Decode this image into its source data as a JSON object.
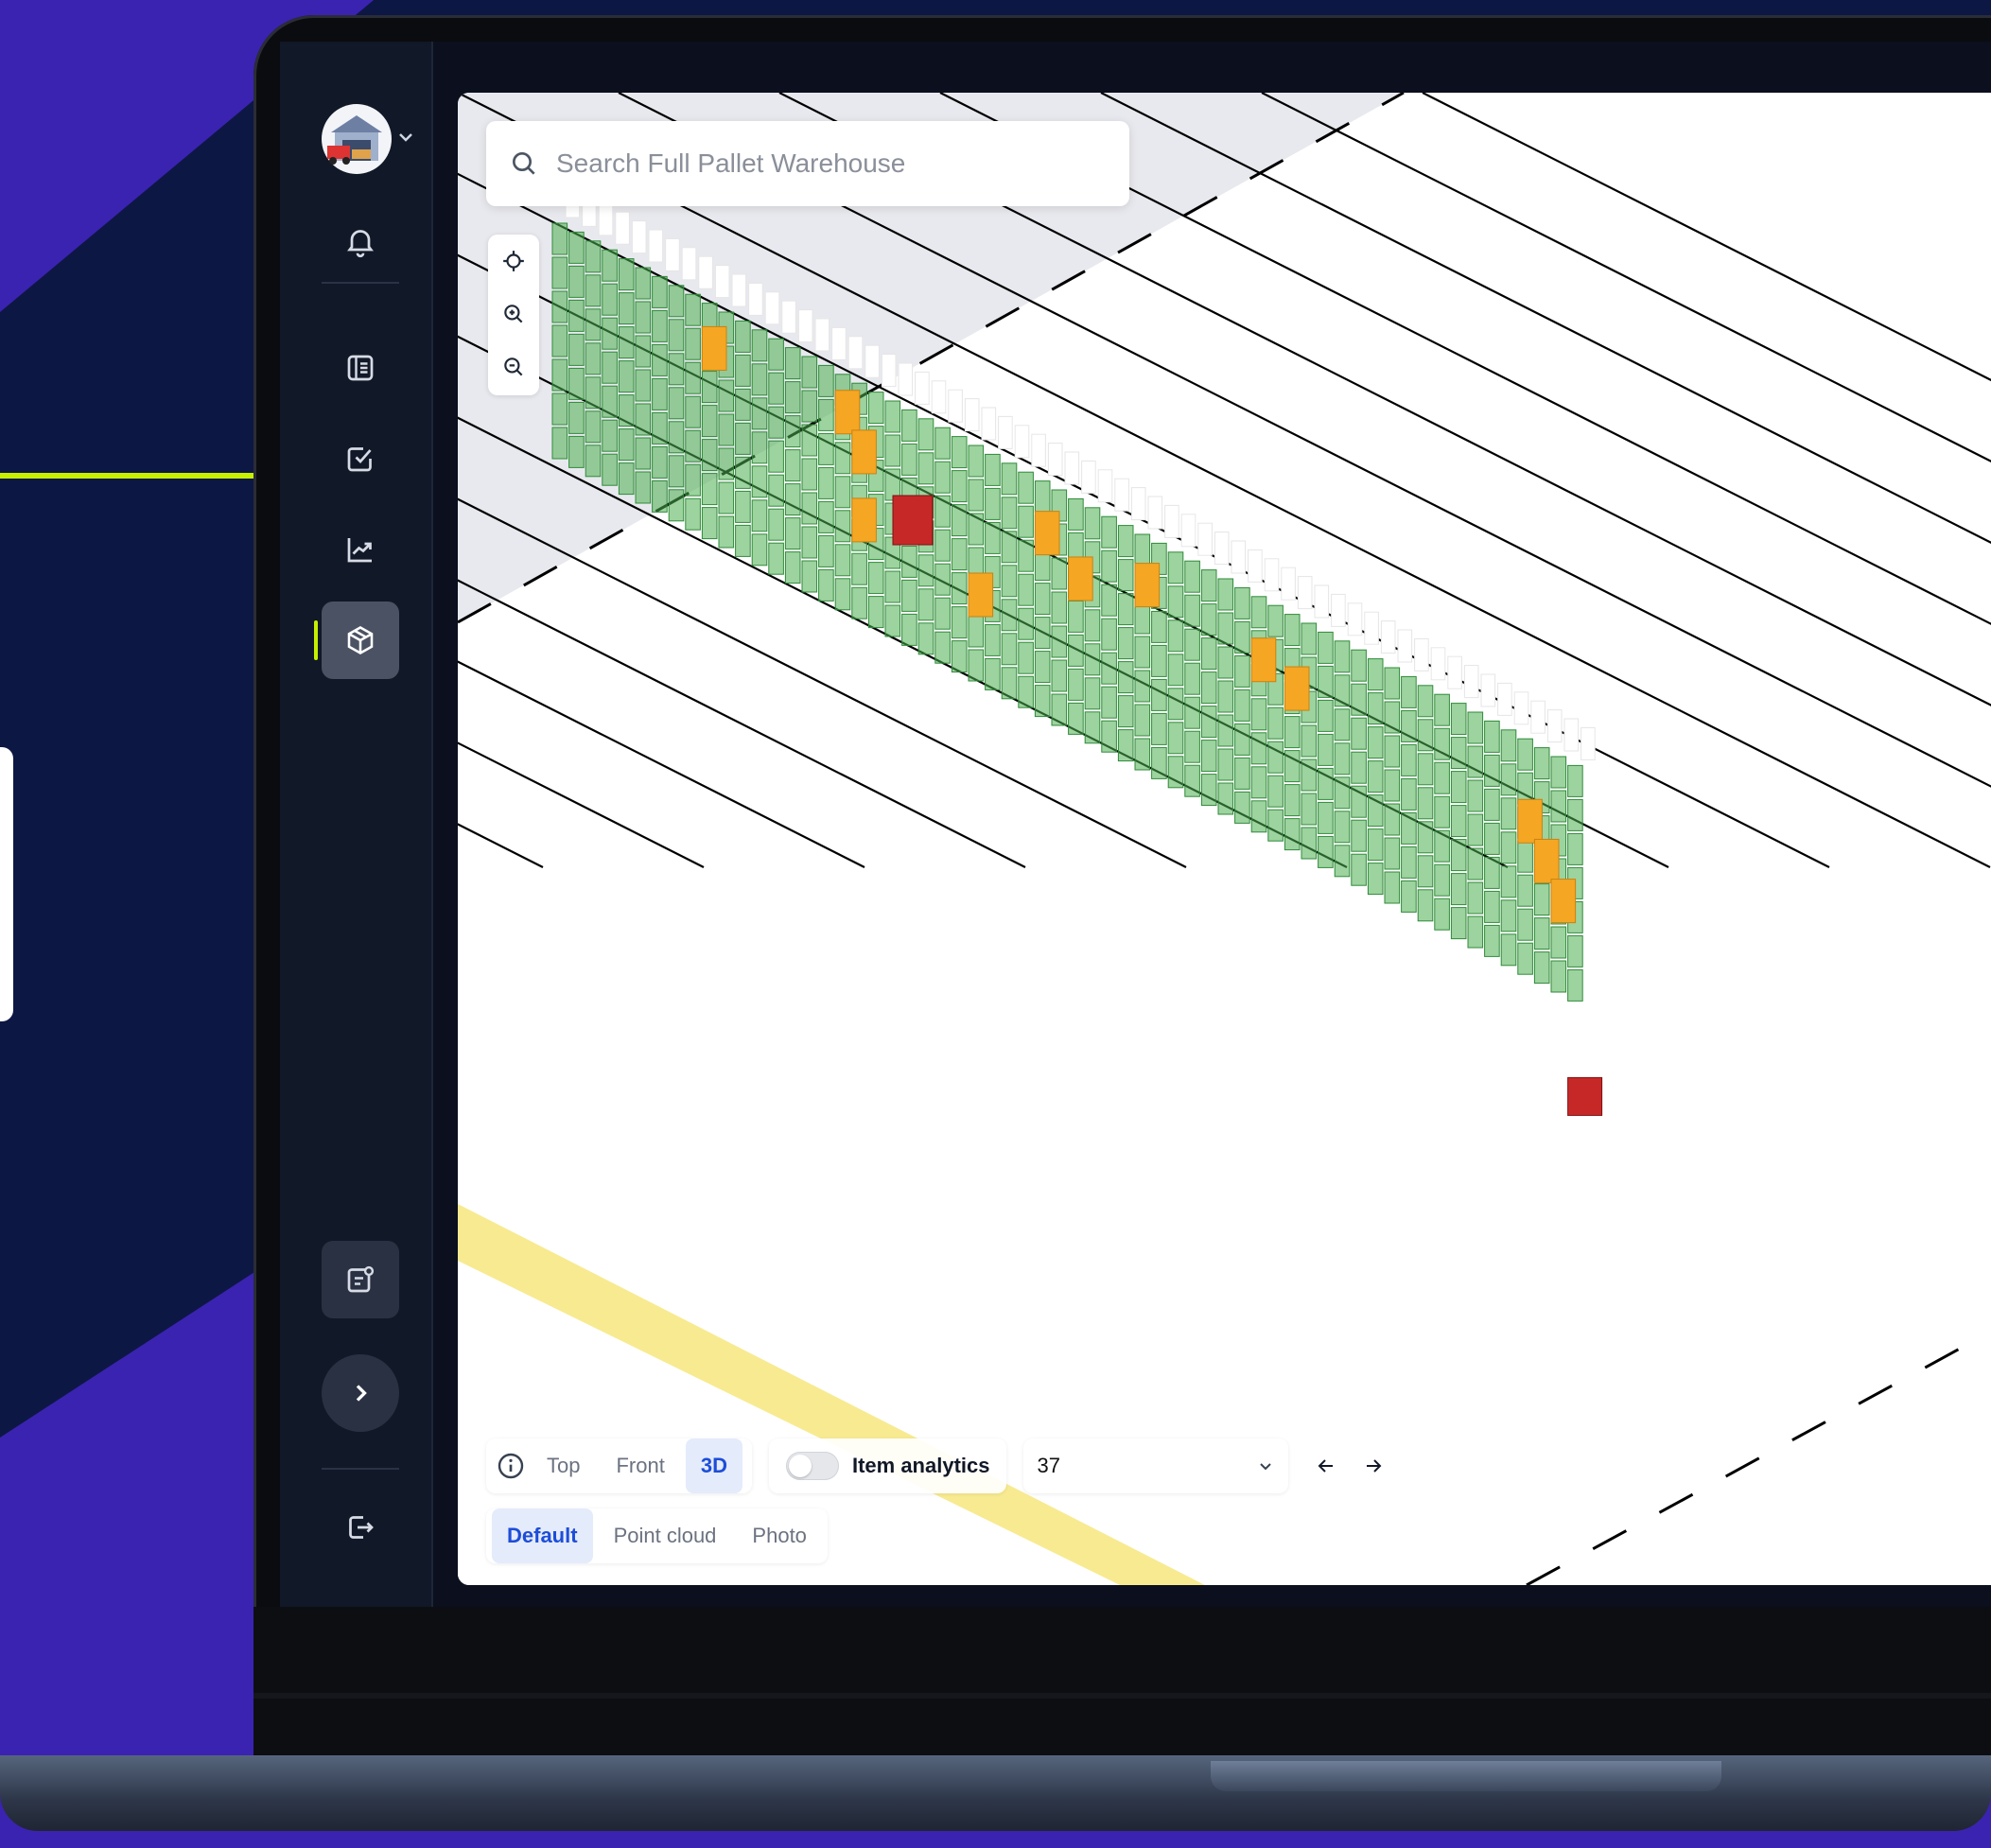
{
  "search": {
    "placeholder": "Search Full Pallet Warehouse"
  },
  "sidebar": {
    "items": [
      {
        "icon": "warehouse-avatar",
        "active": false
      },
      {
        "icon": "bell-icon",
        "active": false
      },
      {
        "icon": "list-icon",
        "active": false
      },
      {
        "icon": "check-square-icon",
        "active": false
      },
      {
        "icon": "chart-icon",
        "active": false
      },
      {
        "icon": "cube-icon",
        "active": true
      },
      {
        "icon": "report-icon",
        "active": false
      },
      {
        "icon": "chevron-right-icon",
        "active": false
      },
      {
        "icon": "logout-icon",
        "active": false
      }
    ]
  },
  "view_controls": {
    "tabs": [
      "Top",
      "Front",
      "3D"
    ],
    "active_tab": "3D",
    "item_analytics_label": "Item analytics",
    "item_analytics_on": false,
    "selected_value": "37"
  },
  "render_modes": {
    "tabs": [
      "Default",
      "Point cloud",
      "Photo"
    ],
    "active_tab": "Default"
  },
  "colors": {
    "background": "#0d1744",
    "accent_band": "#3a23b0",
    "accent_line": "#c6f000",
    "bin_ok": "#4caf50",
    "bin_warning": "#f5a623",
    "bin_error": "#c62828",
    "floor_line": "#000000",
    "yellow_lane": "#f6e36c"
  }
}
